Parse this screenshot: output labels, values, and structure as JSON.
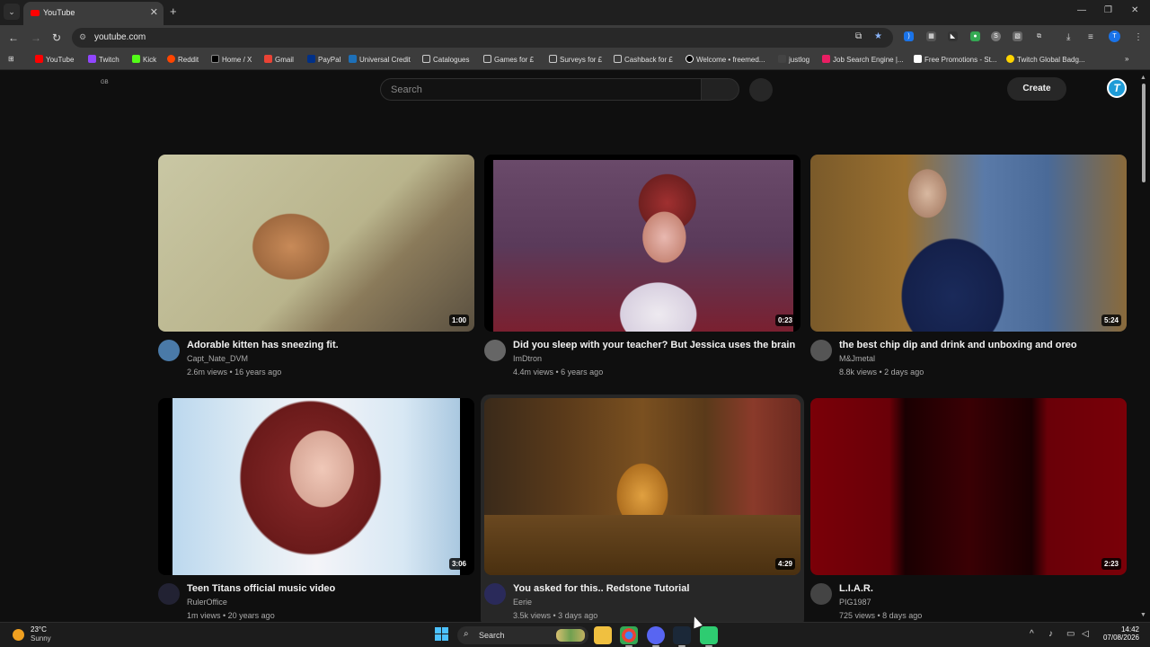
{
  "browser": {
    "tab_title": "YouTube",
    "address": "youtube.com",
    "bookmarks": [
      {
        "label": "YouTube",
        "color": "#ff0000"
      },
      {
        "label": "Twitch",
        "color": "#9146ff"
      },
      {
        "label": "Kick",
        "color": "#53fc18"
      },
      {
        "label": "Reddit",
        "color": "#ff4500"
      },
      {
        "label": "Home / X",
        "color": "#000000"
      },
      {
        "label": "Gmail",
        "color": "#ea4335"
      },
      {
        "label": "PayPal",
        "color": "#003087"
      },
      {
        "label": "Universal Credit",
        "color": "#1d70b8"
      },
      {
        "label": "Catalogues",
        "color": "folder"
      },
      {
        "label": "Games for £",
        "color": "folder"
      },
      {
        "label": "Surveys for £",
        "color": "folder"
      },
      {
        "label": "Cashback for £",
        "color": "folder"
      },
      {
        "label": "Welcome • freemed...",
        "color": "#000000"
      },
      {
        "label": "justlog",
        "color": "#444444"
      },
      {
        "label": "Job Search Engine |...",
        "color": "#e91e63"
      },
      {
        "label": "Free Promotions - St...",
        "color": "#ffffff"
      },
      {
        "label": "Twitch Global Badg...",
        "color": "#ffd400"
      }
    ]
  },
  "youtube": {
    "region": "GB",
    "search_placeholder": "Search",
    "create_label": "Create",
    "avatar_letter": "T",
    "videos": [
      {
        "title": "Adorable kitten has sneezing fit.",
        "channel": "Capt_Nate_DVM",
        "meta": "2.6m views • 16 years ago",
        "duration": "1:00"
      },
      {
        "title": "Did you sleep with your teacher? But Jessica uses the brain",
        "channel": "ImDtron",
        "meta": "4.4m views • 6 years ago",
        "duration": "0:23"
      },
      {
        "title": "the best chip dip and drink and unboxing and oreo",
        "channel": "M&Jmetal",
        "meta": "8.8k views • 2 days ago",
        "duration": "5:24"
      },
      {
        "title": "Teen Titans official music video",
        "channel": "RulerOffice",
        "meta": "1m views • 20 years ago",
        "duration": "3:06"
      },
      {
        "title": "You asked for this.. Redstone Tutorial",
        "channel": "Eerie",
        "meta": "3.5k views • 3 days ago",
        "duration": "4:29"
      },
      {
        "title": "L.I.A.R.",
        "channel": "PIG1987",
        "meta": "725 views • 8 days ago",
        "duration": "2:23"
      }
    ]
  },
  "taskbar": {
    "temperature": "23°C",
    "condition": "Sunny",
    "search_label": "Search",
    "time": "14:42",
    "date": "07/08/2026"
  }
}
